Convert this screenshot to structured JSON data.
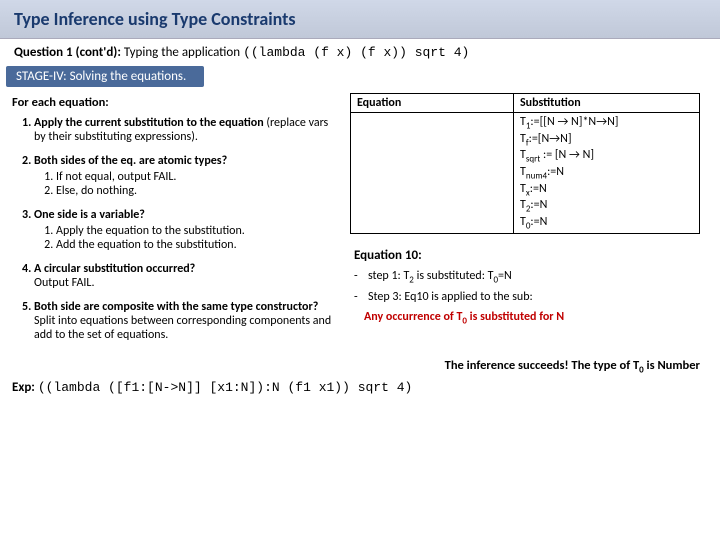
{
  "title": "Type Inference using Type Constraints",
  "question": {
    "label": "Question 1 (cont'd):",
    "lead": "Typing the application",
    "code": "((lambda (f x)  (f x)) sqrt 4)"
  },
  "stage": "STAGE-IV: Solving the equations.",
  "left": {
    "forEach": "For each equation:",
    "steps": [
      {
        "head": "Apply the current substitution to the equation",
        "body": "(replace vars by their substituting expressions)."
      },
      {
        "head": "Both sides of the eq. are atomic types?",
        "subs": [
          "If not equal, output FAIL.",
          "Else, do nothing."
        ]
      },
      {
        "head": "One side is a variable?",
        "subs": [
          "Apply the equation to the substitution.",
          "Add the equation to the substitution."
        ]
      },
      {
        "head": "A circular substitution occurred?",
        "body": "Output FAIL."
      },
      {
        "head": "Both side are composite with the same type constructor?",
        "body": "Split into equations between corresponding components and add to the set of equations."
      }
    ]
  },
  "table": {
    "headers": [
      "Equation",
      "Substitution"
    ],
    "subs": [
      "T₁:=[[N → N]*N→N]",
      "Tբ:=[N→N]",
      "Tₛₒᵣₜ := [N → N]",
      "Tₙᵤₘ₄:=N",
      "Tₓ:=N",
      "T₂:=N",
      "T₀:=N"
    ],
    "subsPlain": {
      "l1a": "T",
      "l1b": "1",
      "l1c": ":=[[N ",
      "l1d": " N]*N",
      "l1e": "N]",
      "l2a": "T",
      "l2b": "f",
      "l2c": ":=[N",
      "l2d": "N]",
      "l3a": "T",
      "l3b": "sqrt",
      "l3c": " := [N ",
      "l3d": " N]",
      "l4a": "T",
      "l4b": "num4",
      "l4c": ":=N",
      "l5a": "T",
      "l5b": "x",
      "l5c": ":=N",
      "l6a": "T",
      "l6b": "2",
      "l6c": ":=N",
      "l7a": "T",
      "l7b": "0",
      "l7c": ":=N"
    }
  },
  "eqBlock": {
    "title": "Equation 10:",
    "items": [
      {
        "pre": "step 1: T",
        "sub": "2",
        "post": " is substituted: T",
        "sub2": "0",
        "post2": "=N"
      },
      {
        "text": "Step 3: Eq10 is applied to the sub:"
      }
    ],
    "red": {
      "pre": "Any occurrence of T",
      "sub": "0",
      "post": " is substituted for N"
    }
  },
  "final": {
    "pre": "The inference succeeds! The type of T",
    "sub": "0",
    "post": " is Number"
  },
  "exp": {
    "label": "Exp:",
    "code": "((lambda ([f1:[N->N]]  [x1:N]):N (f1 x1)) sqrt 4)"
  }
}
